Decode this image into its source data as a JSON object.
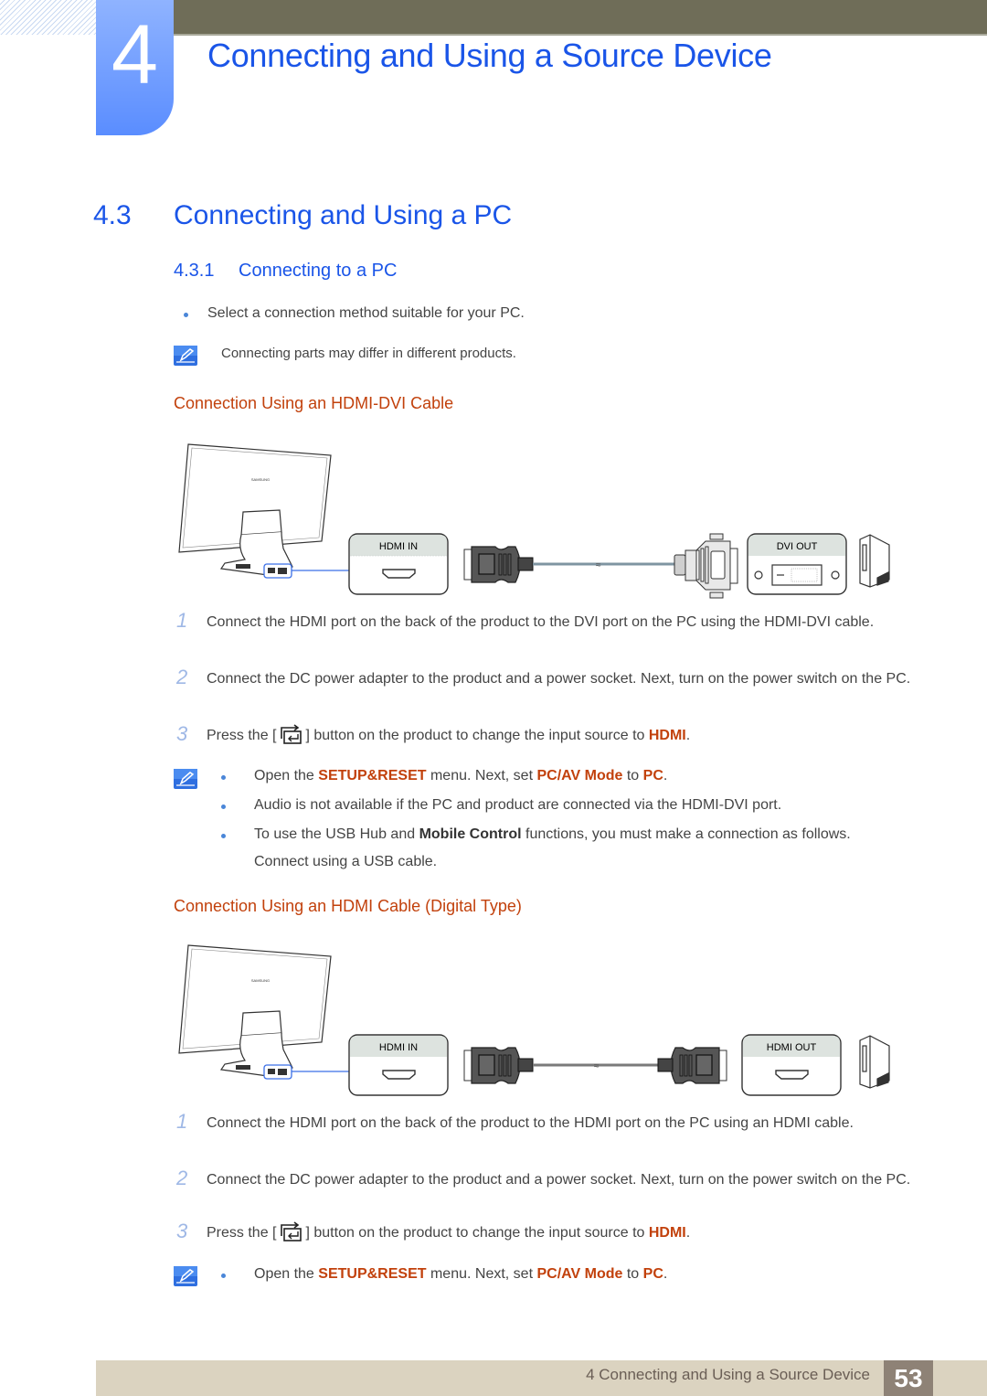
{
  "header": {
    "chapter_number": "4",
    "chapter_title": "Connecting and Using a Source Device"
  },
  "section": {
    "number": "4.3",
    "title": "Connecting and Using a PC"
  },
  "subsection": {
    "number": "4.3.1",
    "title": "Connecting to a PC"
  },
  "intro": {
    "bullet": "Select a connection method suitable for your PC.",
    "note": "Connecting parts may differ in different products."
  },
  "hdmi_dvi": {
    "heading": "Connection Using an HDMI-DVI Cable",
    "diagram": {
      "brand": "SAMSUNG",
      "input_port": "HDMI IN",
      "output_port": "DVI OUT"
    },
    "steps": [
      {
        "num": "1",
        "text": "Connect the HDMI port on the back of the product to the DVI port on the PC using the HDMI-DVI cable."
      },
      {
        "num": "2",
        "text": "Connect the DC power adapter to the product and a power socket. Next, turn on the power switch on the PC."
      },
      {
        "num": "3",
        "pre": "Press the [",
        "post": "] button on the product to change the input source to ",
        "target": "HDMI",
        "end": "."
      }
    ],
    "notes": [
      {
        "t1": "Open the ",
        "b1": "SETUP&RESET",
        "t2": " menu. Next, set ",
        "b2": "PC/AV Mode",
        "t3": " to ",
        "b3": "PC",
        "t4": "."
      },
      {
        "text": "Audio is not available if the PC and product are connected via the HDMI-DVI port."
      },
      {
        "t1": "To use the USB Hub and ",
        "b1": "Mobile Control",
        "t2": " functions, you must make a connection as follows.",
        "line2": "Connect using a USB cable."
      }
    ]
  },
  "hdmi_digital": {
    "heading": "Connection Using an HDMI Cable (Digital Type)",
    "diagram": {
      "brand": "SAMSUNG",
      "input_port": "HDMI IN",
      "output_port": "HDMI OUT"
    },
    "steps": [
      {
        "num": "1",
        "text": "Connect the HDMI port on the back of the product to the HDMI port on the PC using an HDMI cable."
      },
      {
        "num": "2",
        "text": "Connect the DC power adapter to the product and a power socket. Next, turn on the power switch on the PC."
      },
      {
        "num": "3",
        "pre": "Press the [",
        "post": "] button on the product to change the input source to ",
        "target": "HDMI",
        "end": "."
      }
    ],
    "notes": [
      {
        "t1": "Open the ",
        "b1": "SETUP&RESET",
        "t2": " menu. Next, set ",
        "b2": "PC/AV Mode",
        "t3": " to ",
        "b3": "PC",
        "t4": "."
      }
    ]
  },
  "footer": {
    "chapter_ref": "4 Connecting and Using a Source Device",
    "page_number": "53"
  },
  "colors": {
    "heading_blue": "#1a55e8",
    "accent_orange": "#c2410c",
    "header_bar": "#6f6d58",
    "footer_bar": "#dbd3c0",
    "page_badge": "#8e8276"
  }
}
